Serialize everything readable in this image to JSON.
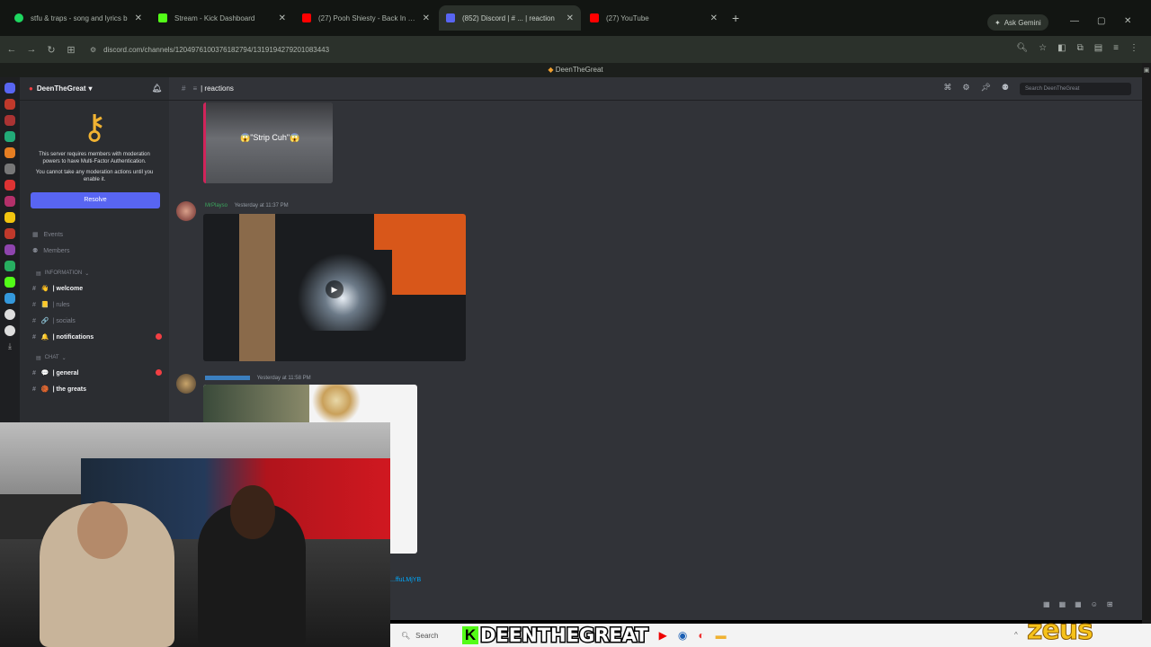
{
  "browser": {
    "tabs": [
      {
        "title": "stfu & traps - song and lyrics b",
        "icon": "spotify-icon",
        "color": "#1ed760",
        "active": false
      },
      {
        "title": "Stream - Kick Dashboard",
        "icon": "kick-icon",
        "color": "#53fc18",
        "active": false
      },
      {
        "title": "(27) Pooh Shiesty - Back In Blo",
        "icon": "youtube-icon",
        "color": "#ff0000",
        "active": false
      },
      {
        "title": "(852) Discord | # ... | reaction",
        "icon": "discord-icon",
        "color": "#5865f2",
        "active": true
      },
      {
        "title": "(27) YouTube",
        "icon": "youtube-icon",
        "color": "#ff0000",
        "active": false
      }
    ],
    "new_tab": "+",
    "gemini_label": "Ask Gemini",
    "url": "discord.com/channels/1204976100376182794/1319194279201083443",
    "window_title": "DeenTheGreat"
  },
  "discord": {
    "server_name": "DeenTheGreat",
    "mfa": {
      "text1": "This server requires members with moderation powers to have Multi-Factor Authentication.",
      "text2": "You cannot take any moderation actions until you enable it.",
      "resolve_label": "Resolve"
    },
    "nav": {
      "events": "Events",
      "members": "Members"
    },
    "categories": {
      "information": "INFORMATION",
      "chat": "CHAT"
    },
    "channels": [
      {
        "name": "| welcome",
        "emoji": "👋",
        "bold": true,
        "unread": false
      },
      {
        "name": "| rules",
        "emoji": "📒",
        "bold": false,
        "unread": false
      },
      {
        "name": "| socials",
        "emoji": "🔗",
        "bold": false,
        "unread": false
      },
      {
        "name": "| notifications",
        "emoji": "🔔",
        "bold": true,
        "unread": true
      }
    ],
    "chat_channels": [
      {
        "name": "| general",
        "emoji": "💬",
        "bold": true,
        "unread": true
      },
      {
        "name": "| the greats",
        "emoji": "🏀",
        "bold": true,
        "unread": false
      }
    ],
    "channel_header": "| reactions",
    "search_placeholder": "Search DeenTheGreat",
    "messages": [
      {
        "caption": "😱\"Strip Cuh\"😱"
      },
      {
        "author": "MrPlayso",
        "time": "Yesterday at 11:37 PM"
      },
      {
        "author": "",
        "time": "Yesterday at 11:58 PM"
      }
    ],
    "link_fragment": "...ffuLMjYB"
  },
  "taskbar": {
    "search_label": "Search",
    "streamer_name": "DEENTHEGREAT",
    "kick_letter": "K",
    "sponsor_watermark": "zeus"
  }
}
